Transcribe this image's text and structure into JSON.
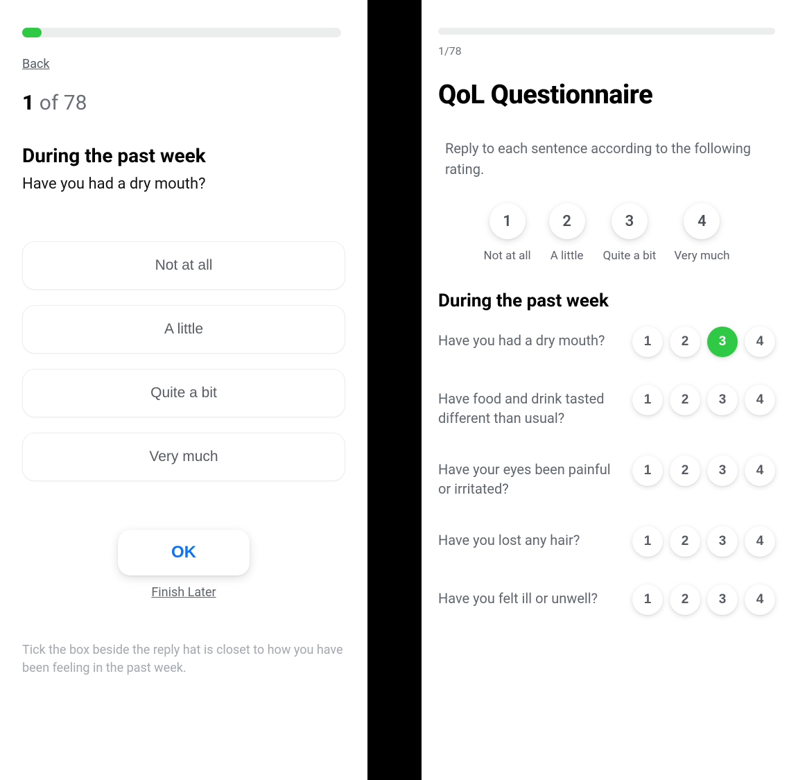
{
  "left": {
    "back_label": "Back",
    "step_current": "1",
    "step_sep": " of ",
    "step_total": "78",
    "heading": "During the past week",
    "question": "Have you had a dry mouth?",
    "options": [
      "Not at all",
      "A little",
      "Quite a bit",
      "Very much"
    ],
    "ok_label": "OK",
    "finish_later_label": "Finish Later",
    "footnote": "Tick the box beside the reply hat is closet to how you have been feeling in the past week."
  },
  "right": {
    "step_text": "1/78",
    "title": "QoL Questionnaire",
    "instruction": "Reply to each sentence according to the following rating.",
    "legend": [
      {
        "num": "1",
        "label": "Not at all"
      },
      {
        "num": "2",
        "label": "A little"
      },
      {
        "num": "3",
        "label": "Quite a bit"
      },
      {
        "num": "4",
        "label": "Very much"
      }
    ],
    "section_heading": "During the past week",
    "choice_values": [
      "1",
      "2",
      "3",
      "4"
    ],
    "questions": [
      {
        "text": "Have you had a dry mouth?",
        "selected": 3
      },
      {
        "text": "Have food and drink tasted different than usual?",
        "selected": null
      },
      {
        "text": "Have your eyes been painful or irritated?",
        "selected": null
      },
      {
        "text": "Have you lost any hair?",
        "selected": null
      },
      {
        "text": "Have you felt ill or unwell?",
        "selected": null
      }
    ]
  }
}
